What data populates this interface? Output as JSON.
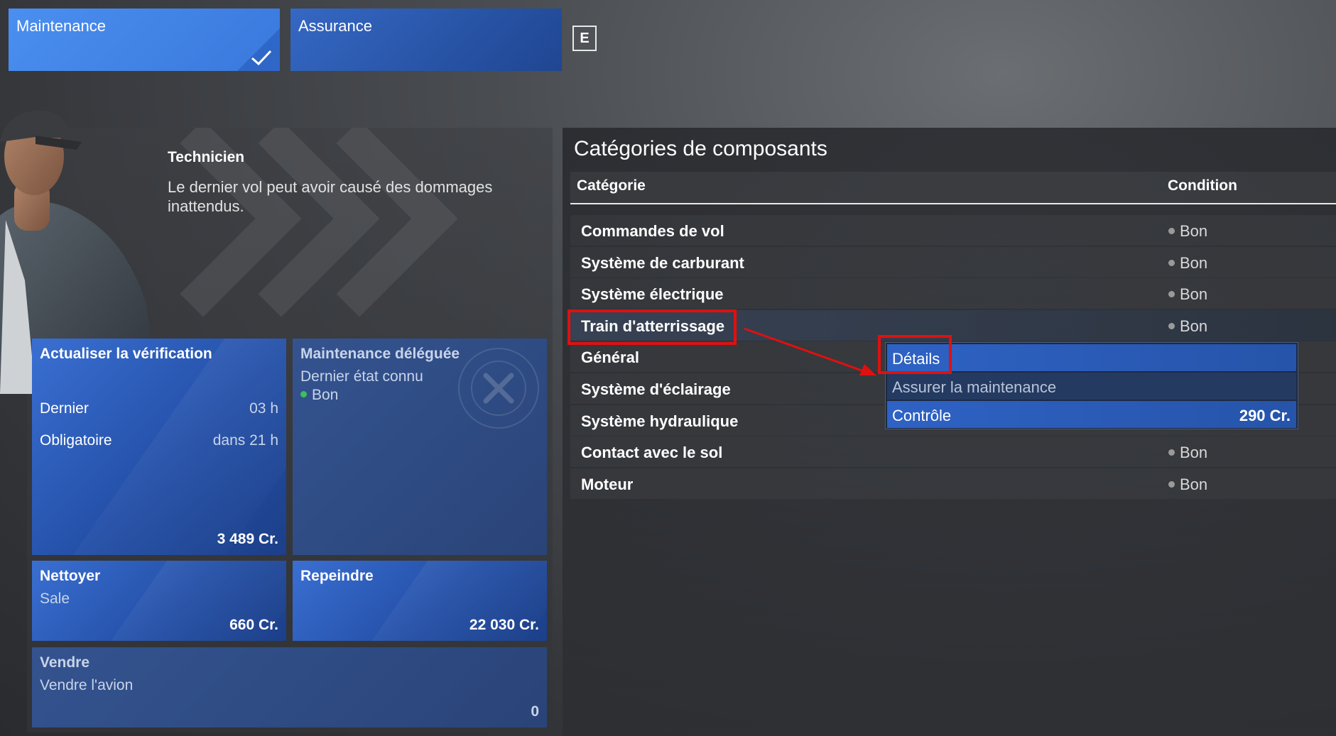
{
  "tabs": [
    {
      "label": "Maintenance",
      "active": true
    },
    {
      "label": "Assurance",
      "active": false
    }
  ],
  "key_hint": "E",
  "technician": {
    "title": "Technicien",
    "message": "Le dernier vol peut avoir causé des dommages inattendus."
  },
  "cards": {
    "refresh_check": {
      "title": "Actualiser la vérification",
      "last_label": "Dernier",
      "last_value": "03 h",
      "required_label": "Obligatoire",
      "required_value": "dans 21 h",
      "price": "3 489 Cr."
    },
    "delegated": {
      "title": "Maintenance déléguée",
      "subtitle": "Dernier état connu",
      "status": "Bon"
    },
    "clean": {
      "title": "Nettoyer",
      "subtitle": "Sale",
      "price": "660 Cr."
    },
    "repaint": {
      "title": "Repeindre",
      "price": "22 030 Cr."
    },
    "sell": {
      "title": "Vendre",
      "subtitle": "Vendre l'avion",
      "price": "0"
    }
  },
  "components": {
    "title": "Catégories de composants",
    "col_category": "Catégorie",
    "col_condition": "Condition",
    "rows": [
      {
        "category": "Commandes de vol",
        "condition": "Bon"
      },
      {
        "category": "Système de carburant",
        "condition": "Bon"
      },
      {
        "category": "Système électrique",
        "condition": "Bon"
      },
      {
        "category": "Train d'atterrissage",
        "condition": "Bon"
      },
      {
        "category": "Général",
        "condition": ""
      },
      {
        "category": "Système d'éclairage",
        "condition": ""
      },
      {
        "category": "Système hydraulique",
        "condition": ""
      },
      {
        "category": "Contact avec le sol",
        "condition": "Bon"
      },
      {
        "category": "Moteur",
        "condition": "Bon"
      }
    ]
  },
  "context_menu": {
    "details": "Détails",
    "ensure_maintenance": "Assurer la maintenance",
    "control": "Contrôle",
    "control_price": "290 Cr."
  },
  "colors": {
    "accent_blue": "#3a78dc",
    "annotation_red": "#e01010",
    "status_green": "#3dbf5a"
  }
}
